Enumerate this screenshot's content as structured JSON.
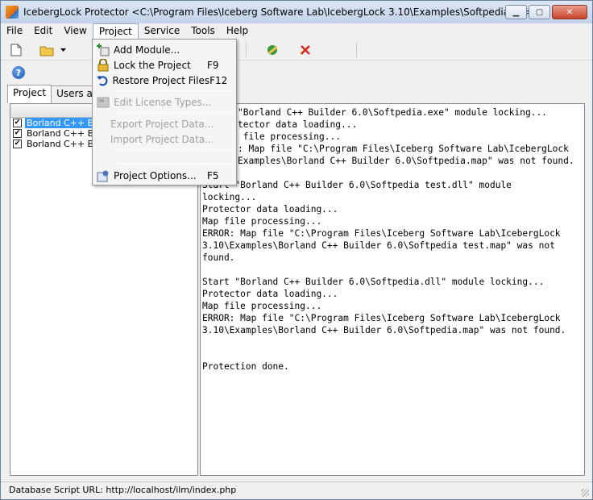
{
  "window": {
    "title": "IcebergLock Protector <C:\\Program Files\\Iceberg Software Lab\\IcebergLock 3.10\\Examples\\Softpedia.ilp>"
  },
  "menubar": {
    "items": [
      {
        "label": "File"
      },
      {
        "label": "Edit"
      },
      {
        "label": "View"
      },
      {
        "label": "Project"
      },
      {
        "label": "Service"
      },
      {
        "label": "Tools"
      },
      {
        "label": "Help"
      }
    ]
  },
  "project_menu": {
    "add_module": {
      "label": "Add Module...",
      "shortcut": ""
    },
    "lock_project": {
      "label": "Lock the Project",
      "shortcut": "F9"
    },
    "restore_files": {
      "label": "Restore Project Files",
      "shortcut": "F12"
    },
    "edit_license": {
      "label": "Edit License Types...",
      "shortcut": ""
    },
    "export_data": {
      "label": "Export Project Data...",
      "shortcut": ""
    },
    "import_data": {
      "label": "Import Project Data...",
      "shortcut": ""
    },
    "project_options": {
      "label": "Project Options...",
      "shortcut": "F5"
    }
  },
  "tabs": [
    {
      "label": "Project"
    },
    {
      "label": "Users and"
    }
  ],
  "module_list": {
    "header": "M",
    "rows": [
      {
        "label": "Borland C++ Build"
      },
      {
        "label": "Borland C++ Build"
      },
      {
        "label": "Borland C++ Build"
      }
    ]
  },
  "log": {
    "lines": [
      "\"Borland C++ Builder 6.0\\Softpedia.exe\" module locking...",
      "tector data loading...",
      " file processing...",
      ": Map file \"C:\\Program Files\\Iceberg Software Lab\\IcebergLock",
      "Examples\\Borland C++ Builder 6.0\\Softpedia.map\" was not found.",
      "",
      "Start \"Borland C++ Builder 6.0\\Softpedia test.dll\" module",
      "locking...",
      "Protector data loading...",
      "Map file processing...",
      "ERROR: Map file \"C:\\Program Files\\Iceberg Software Lab\\IcebergLock",
      "3.10\\Examples\\Borland C++ Builder 6.0\\Softpedia test.map\" was not",
      "found.",
      "",
      "Start \"Borland C++ Builder 6.0\\Softpedia.dll\" module locking...",
      "Protector data loading...",
      "Map file processing...",
      "ERROR: Map file \"C:\\Program Files\\Iceberg Software Lab\\IcebergLock",
      "3.10\\Examples\\Borland C++ Builder 6.0\\Softpedia.map\" was not found.",
      "",
      "",
      "Protection done."
    ]
  },
  "statusbar": {
    "text": "Database Script URL: http://localhost/ilm/index.php"
  }
}
